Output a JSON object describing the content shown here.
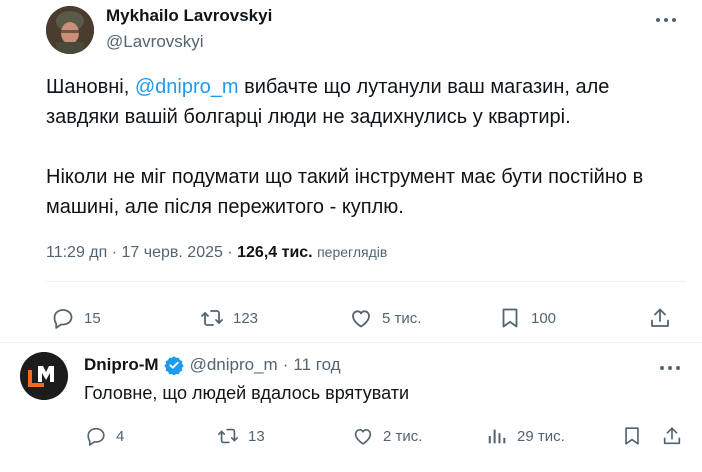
{
  "main_tweet": {
    "author_name": "Mykhailo Lavrovskyi",
    "author_handle": "@Lavrovskyi",
    "text_part1": "Шановні, ",
    "mention": "@dnipro_m",
    "text_part2": " вибачте що лутанули ваш магазин, але",
    "text_line2": "завдяки вашій болгарці люди не задихнулись у квартирі.",
    "text_para2_line1": "Ніколи не міг подумати що такий інструмент має бути постійно в",
    "text_para2_line2": "машині, але після пережитого - куплю.",
    "time": "11:29 дп",
    "date": "17 черв. 2025",
    "views_count": "126,4 тис.",
    "views_label": "переглядів",
    "replies": "15",
    "reposts": "123",
    "likes": "5 тис.",
    "bookmarks": "100"
  },
  "reply_tweet": {
    "author_name": "Dnipro-M",
    "author_handle": "@dnipro_m",
    "time_ago": "11 год",
    "text": "Головне, що людей вдалось врятувати",
    "replies": "4",
    "reposts": "13",
    "likes": "2 тис.",
    "views": "29 тис."
  },
  "separators": {
    "meta_dot": "·"
  },
  "icons": [
    "more-icon",
    "reply-icon",
    "repost-icon",
    "like-icon",
    "bookmark-icon",
    "share-icon",
    "views-icon",
    "verified-icon"
  ],
  "colors": {
    "accent": "#1d9bf0",
    "secondary_text": "#536471",
    "brand_orange": "#f26a21"
  }
}
